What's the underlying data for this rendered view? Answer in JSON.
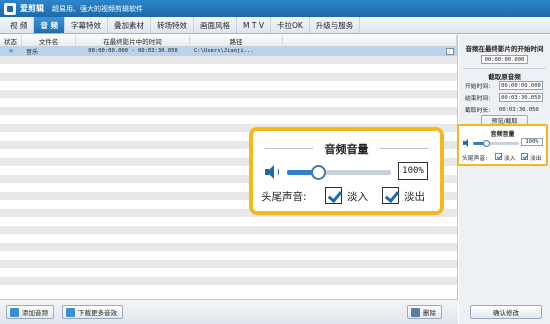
{
  "app": {
    "name": "爱剪辑",
    "slogan": "超易用、强大的视频剪辑软件"
  },
  "tabs": [
    {
      "label": "视  频"
    },
    {
      "label": "音  频"
    },
    {
      "label": "字幕特效"
    },
    {
      "label": "叠加素材"
    },
    {
      "label": "转场特效"
    },
    {
      "label": "画面风格"
    },
    {
      "label": "M T V"
    },
    {
      "label": "卡拉OK"
    },
    {
      "label": "升级与服务"
    }
  ],
  "active_tab": "音  频",
  "list": {
    "headers": [
      "状态",
      "文件名",
      "在最终影片中的时间",
      "路径"
    ],
    "rows": [
      {
        "status": "✳",
        "name": "音乐",
        "time": "00:00:00.000 - 00:03:30.050",
        "path": "C:\\Users\\Jiaoji..."
      }
    ]
  },
  "bottom_toolbar": {
    "add_audio": "添加音频",
    "download_more": "下载更多音效",
    "delete": "删除"
  },
  "right_panel": {
    "start_time_title": "音频在最终影片的开始时间",
    "start_time_value": "00:00:00.000",
    "trim_title": "截取原音频",
    "start_label": "开始时间:",
    "start_value": "00:00:00.000",
    "end_label": "结束时间:",
    "end_value": "00:03:30.050",
    "duration_label": "截取时长:",
    "duration_value": "00:03:30.050",
    "preview_button": "预览/截取",
    "volume_title": "音频音量",
    "volume_value": "100%",
    "fade_label": "头尾声音:",
    "fade_in": "淡入",
    "fade_out": "淡出",
    "confirm_button": "确认修改"
  },
  "callout": {
    "title": "音频音量",
    "volume_value": "100%",
    "fade_label": "头尾声音:",
    "fade_in": "淡入",
    "fade_out": "淡出"
  },
  "volume_level": 0.3,
  "fade_in_checked": true,
  "fade_out_checked": true,
  "colors": {
    "accent": "#1a6aad",
    "highlight": "#f4b821"
  }
}
